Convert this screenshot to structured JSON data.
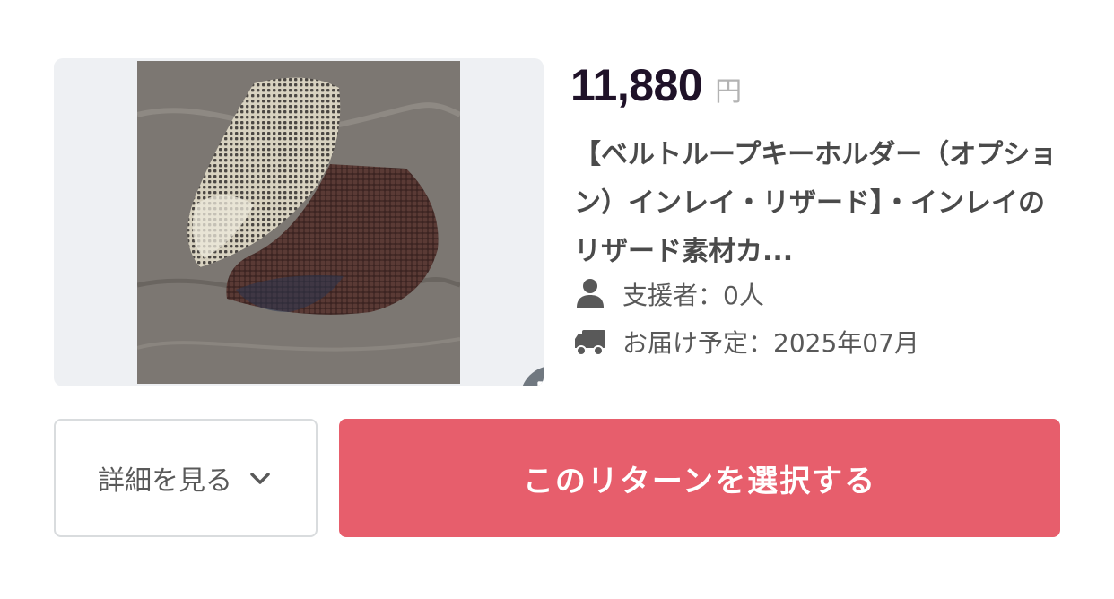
{
  "reward": {
    "price": "11,880",
    "currency": "円",
    "title": "【ベルトループキーホルダー（オプション）インレイ・リザード】・インレイのリザード素材カ...",
    "supporters_text": "支援者：0人",
    "delivery_text": "お届け予定：2025年07月"
  },
  "icons": {
    "expand": "expand-icon",
    "person": "person-icon",
    "truck": "truck-icon",
    "chevron": "chevron-down-icon"
  },
  "actions": {
    "details_label": "詳細を見る",
    "select_label": "このリターンを選択する"
  },
  "colors": {
    "accent": "#e75e6c",
    "price": "#1f1228",
    "image_bg": "#eef0f3"
  }
}
